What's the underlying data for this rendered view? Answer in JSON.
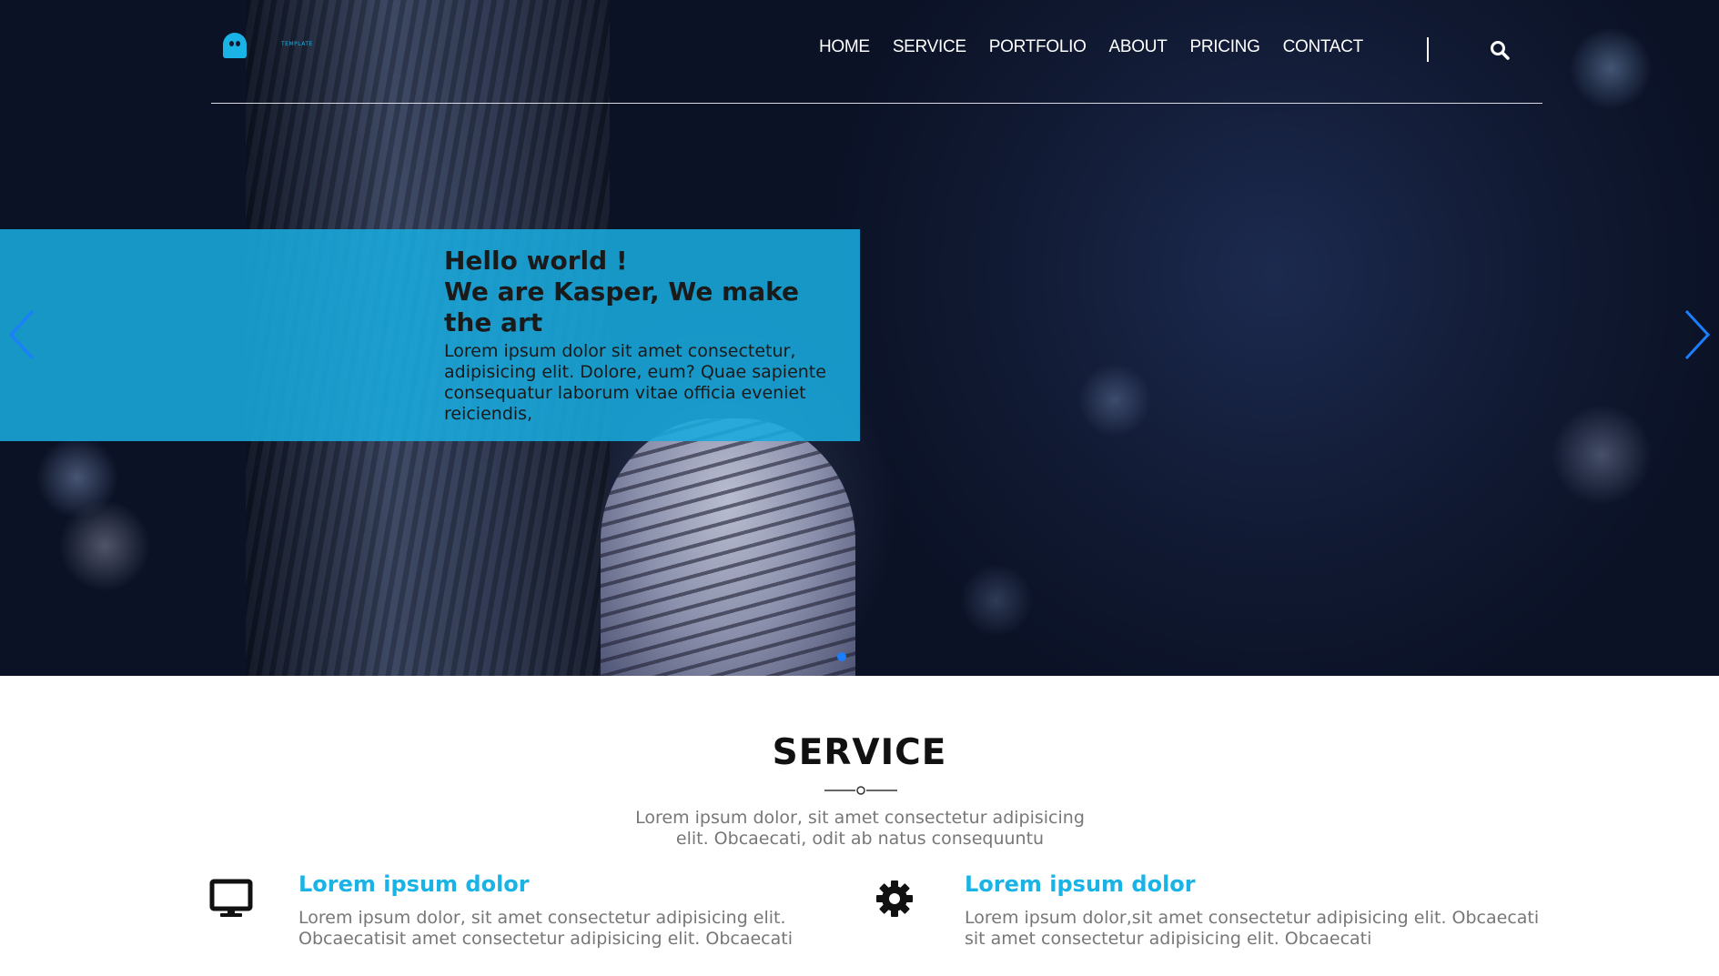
{
  "header": {
    "logo_text": "TEMPLATE",
    "nav": [
      "HOME",
      "SERVICE",
      "PORTFOLIO",
      "ABOUT",
      "PRICING",
      "CONTACT"
    ]
  },
  "hero": {
    "title_line1": "Hello world !",
    "title_line2": "We are Kasper, We make the art",
    "text": "Lorem ipsum dolor sit amet consectetur, adipisicing elit. Dolore, eum? Quae sapiente consequatur laborum vitae officia eveniet reiciendis,",
    "accent_color": "#18aadd",
    "arrow_color": "#1a7fff"
  },
  "service": {
    "title": "SERVICE",
    "description": "Lorem ipsum dolor, sit amet consectetur adipisicing elit. Obcaecati, odit ab natus consequuntu",
    "features": [
      {
        "icon": "monitor-icon",
        "title": "Lorem ipsum dolor",
        "text": "Lorem ipsum dolor, sit amet consectetur adipisicing elit. Obcaecatisit amet consectetur adipisicing elit. Obcaecati"
      },
      {
        "icon": "gear-icon",
        "title": "Lorem ipsum dolor",
        "text": "Lorem ipsum dolor,sit amet consectetur adipisicing elit. Obcaecati sit amet consectetur adipisicing elit. Obcaecati"
      }
    ]
  }
}
